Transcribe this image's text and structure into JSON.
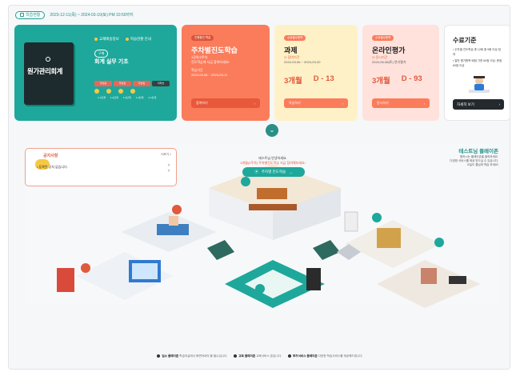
{
  "topbar": {
    "badge_label": "학습현황",
    "period": "2023-12-11(목) ~ 2024-03-10(토) PM 10:59까지"
  },
  "course_card": {
    "book_title": "원가관리회계",
    "book_sub": "",
    "tags": [
      "교재배송정보",
      "학습현황 안내"
    ],
    "badge": "구매",
    "course_name": "회계 실무 기초",
    "chapters": [
      "학습중",
      "학습중",
      "학습중",
      "미학습"
    ],
    "steps": [
      "1-1단계",
      "1-2단계",
      "1-3단계",
      "1-4단계",
      "2-1단계"
    ]
  },
  "guided_card": {
    "badge": "진행중인 학습",
    "title": "주차별진도학습",
    "line1": "1강의/2주차",
    "line2": "진도학습에 지금 참여하세요!",
    "line3": "학습기간",
    "line4": "2024-03-06 ~ 2024-03-11",
    "button": "참여하기"
  },
  "assignment_card": {
    "badge": "수료필수항목",
    "title": "과제",
    "status": "참여기간",
    "period": "2024-03-06 ~ 2024-03-20",
    "months": "3개월",
    "dday": "D - 13",
    "button": "작성하기"
  },
  "exam_card": {
    "badge": "수료필수항목",
    "title": "온라인평가",
    "status": "응시기간",
    "period": "2024-06-08(토) 연기평가",
    "months": "3개월",
    "dday": "D - 93",
    "button": "응시하기"
  },
  "criteria_card": {
    "title": "수료기준",
    "items": [
      "주차별 진도학습 총 12회 중 9회 이상 참여",
      "일반 평가항목 배점 기준 60점 이상, 총점 60점 이상"
    ],
    "button": "자세히 보기"
  },
  "notice": {
    "title": "공지사항",
    "more": "더보기 >",
    "text": "등록된 공지 없습니다."
  },
  "greeting": {
    "line1": "테스트님 안녕하세요.",
    "line2": "3개월(2주차) 주차별진도학습 지금 참여해보세요!",
    "button": "주차별 진도학습"
  },
  "platform": {
    "title": "테스트님 플레이존",
    "line1": "원하시는 플레이존을 클릭하세요.",
    "line2": "다양한 서비스를 제공 받으실 수 있습니다.",
    "line3": "오늘도 즐겁게 학습 하세요!"
  },
  "footer": {
    "item1_title": "입소 플레이존",
    "item1_text": "학습하실에서 화면하셔야 할 필수입니다.",
    "item2_title": "교육 플레이존",
    "item2_text": "교육서비스 존입니다.",
    "item3_title": "부가서비스 플레이존",
    "item3_text": "다양한 학습서비스를 제공해드립니다."
  },
  "colors": {
    "teal": "#1ea89b",
    "orange": "#fb7c5b",
    "yellow": "#fff1c7",
    "pink": "#ffe2dc",
    "accent_red": "#e05a3c"
  }
}
